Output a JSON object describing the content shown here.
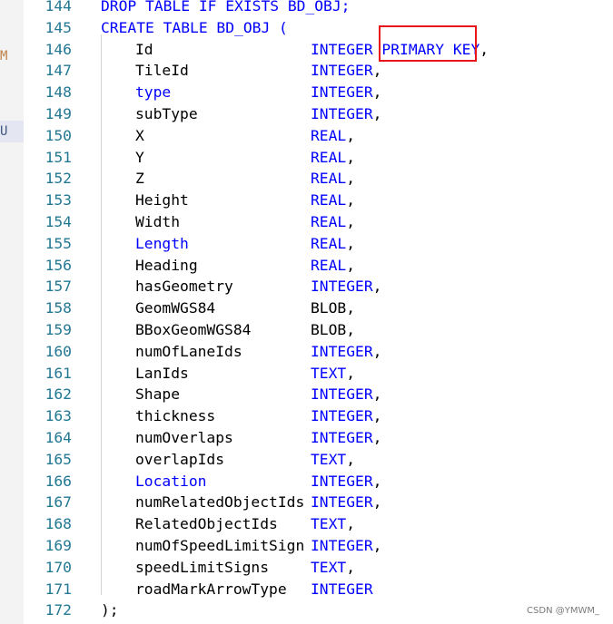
{
  "gutter": {
    "marker_m": "M",
    "marker_u": "U"
  },
  "lines": [
    {
      "no": "144",
      "text": "DROP TABLE IF EXISTS BD_OBJ;"
    },
    {
      "no": "145",
      "text": "CREATE TABLE BD_OBJ ("
    },
    {
      "no": "146",
      "name": "Id",
      "type": "INTEGER PRIMARY KEY",
      "sep": ","
    },
    {
      "no": "147",
      "name": "TileId",
      "type": "INTEGER",
      "sep": ","
    },
    {
      "no": "148",
      "name": "type",
      "type": "INTEGER",
      "sep": ","
    },
    {
      "no": "149",
      "name": "subType",
      "type": "INTEGER",
      "sep": ","
    },
    {
      "no": "150",
      "name": "X",
      "type": "REAL",
      "sep": ","
    },
    {
      "no": "151",
      "name": "Y",
      "type": "REAL",
      "sep": ","
    },
    {
      "no": "152",
      "name": "Z",
      "type": "REAL",
      "sep": ","
    },
    {
      "no": "153",
      "name": "Height",
      "type": "REAL",
      "sep": ","
    },
    {
      "no": "154",
      "name": "Width",
      "type": "REAL",
      "sep": ","
    },
    {
      "no": "155",
      "name": "Length",
      "type": "REAL",
      "sep": ","
    },
    {
      "no": "156",
      "name": "Heading",
      "type": "REAL",
      "sep": ","
    },
    {
      "no": "157",
      "name": "hasGeometry",
      "type": "INTEGER",
      "sep": ","
    },
    {
      "no": "158",
      "name": "GeomWGS84",
      "type": "BLOB",
      "sep": ","
    },
    {
      "no": "159",
      "name": "BBoxGeomWGS84",
      "type": "BLOB",
      "sep": ","
    },
    {
      "no": "160",
      "name": "numOfLaneIds",
      "type": "INTEGER",
      "sep": ","
    },
    {
      "no": "161",
      "name": "LanIds",
      "type": "TEXT",
      "sep": ","
    },
    {
      "no": "162",
      "name": "Shape",
      "type": "INTEGER",
      "sep": ","
    },
    {
      "no": "163",
      "name": "thickness",
      "type": "INTEGER",
      "sep": ","
    },
    {
      "no": "164",
      "name": "numOverlaps",
      "type": "INTEGER",
      "sep": ","
    },
    {
      "no": "165",
      "name": "overlapIds",
      "type": "TEXT",
      "sep": ","
    },
    {
      "no": "166",
      "name": "Location",
      "type": "INTEGER",
      "sep": ","
    },
    {
      "no": "167",
      "name": "numRelatedObjectIds",
      "type": "INTEGER",
      "sep": ","
    },
    {
      "no": "168",
      "name": "RelatedObjectIds",
      "type": "TEXT",
      "sep": ","
    },
    {
      "no": "169",
      "name": "numOfSpeedLimitSign",
      "type": "INTEGER",
      "sep": ","
    },
    {
      "no": "170",
      "name": "speedLimitSigns",
      "type": "TEXT",
      "sep": ","
    },
    {
      "no": "171",
      "name": "roadMarkArrowType",
      "type": "INTEGER",
      "sep": ""
    },
    {
      "no": "172",
      "text": ");"
    }
  ],
  "keyword_names": [
    "type",
    "Length",
    "Location"
  ],
  "plain_types": [
    "BLOB"
  ],
  "watermark": "CSDN @YMWM_"
}
